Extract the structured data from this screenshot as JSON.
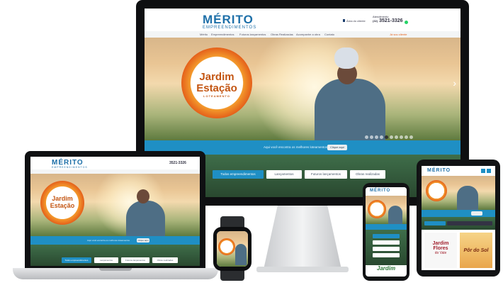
{
  "brand": {
    "name": "MÉRITO",
    "tagline": "EMPREENDIMENTOS",
    "accent": "#1f8fc4",
    "orange": "#e5621b",
    "green": "#2f5a36"
  },
  "header": {
    "client_area": "Área do cliente",
    "phone_label": "Atendimento",
    "phone": "3521-3326",
    "phone_prefix": "(32)"
  },
  "nav": {
    "items": [
      "Mérito",
      "Empreendimentos",
      "Futuros lançamentos",
      "Obras Realizadas",
      "Acompanhe a obra",
      "Contato"
    ],
    "cta": "Já sou cliente"
  },
  "hero": {
    "badge_line1": "Jardim",
    "badge_line2": "Estação",
    "badge_sub": "LOTEAMENTO"
  },
  "band": {
    "text": "Aqui você encontra os melhores loteamentos",
    "button": "Clique aqui"
  },
  "tabs": [
    "Todos empreendimentos",
    "Lançamentos",
    "Futuros lançamentos",
    "Obras realizadas"
  ],
  "tablet": {
    "card1_line1": "Jardim",
    "card1_line2": "Flores",
    "card1_line3": "do Vale",
    "card2": "Pôr do Sol"
  },
  "phone": {
    "footer_logo": "Jardim"
  },
  "arrows": {
    "right": "›"
  }
}
